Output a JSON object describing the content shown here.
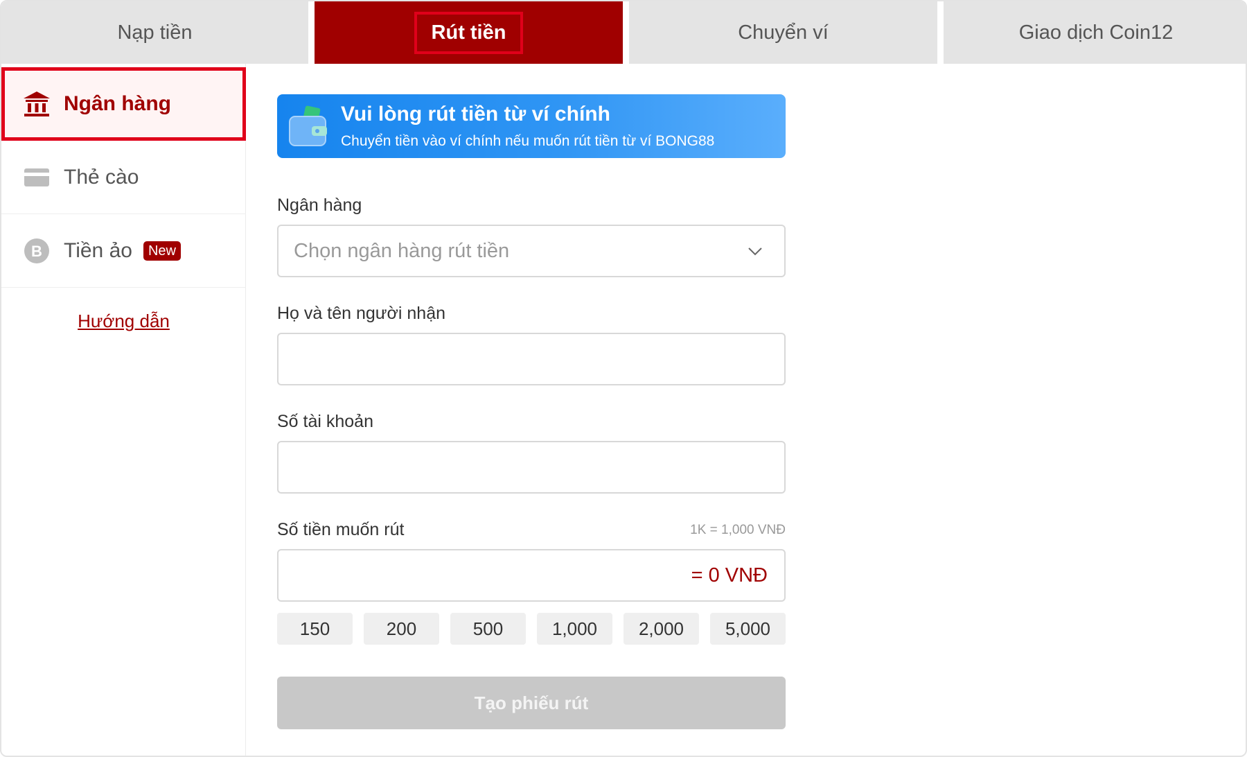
{
  "tabs": [
    {
      "label": "Nạp tiền"
    },
    {
      "label": "Rút tiền"
    },
    {
      "label": "Chuyển ví"
    },
    {
      "label": "Giao dịch Coin12"
    }
  ],
  "colors": {
    "accent": "#a00000",
    "highlight": "#e0001a",
    "banner": "#2f95f4"
  },
  "sidebar": {
    "items": [
      {
        "label": "Ngân hàng",
        "icon": "bank-icon"
      },
      {
        "label": "Thẻ cào",
        "icon": "card-icon"
      },
      {
        "label": "Tiền ảo",
        "icon": "bitcoin-icon",
        "badge": "New"
      }
    ],
    "guide": "Hướng dẫn"
  },
  "banner": {
    "title": "Vui lòng rút tiền từ ví chính",
    "subtitle": "Chuyển tiền vào ví chính nếu muốn rút tiền từ ví BONG88",
    "icon": "wallet-icon"
  },
  "form": {
    "bank_label": "Ngân hàng",
    "bank_placeholder": "Chọn ngân hàng rút tiền",
    "name_label": "Họ và tên người nhận",
    "name_value": "",
    "account_label": "Số tài khoản",
    "account_value": "",
    "amount_label": "Số tiền muốn rút",
    "amount_hint": "1K = 1,000 VNĐ",
    "amount_value": "",
    "amount_equivalent": "= 0 VNĐ",
    "quick_amounts": [
      "150",
      "200",
      "500",
      "1,000",
      "2,000",
      "5,000"
    ],
    "submit_label": "Tạo phiếu rút"
  }
}
